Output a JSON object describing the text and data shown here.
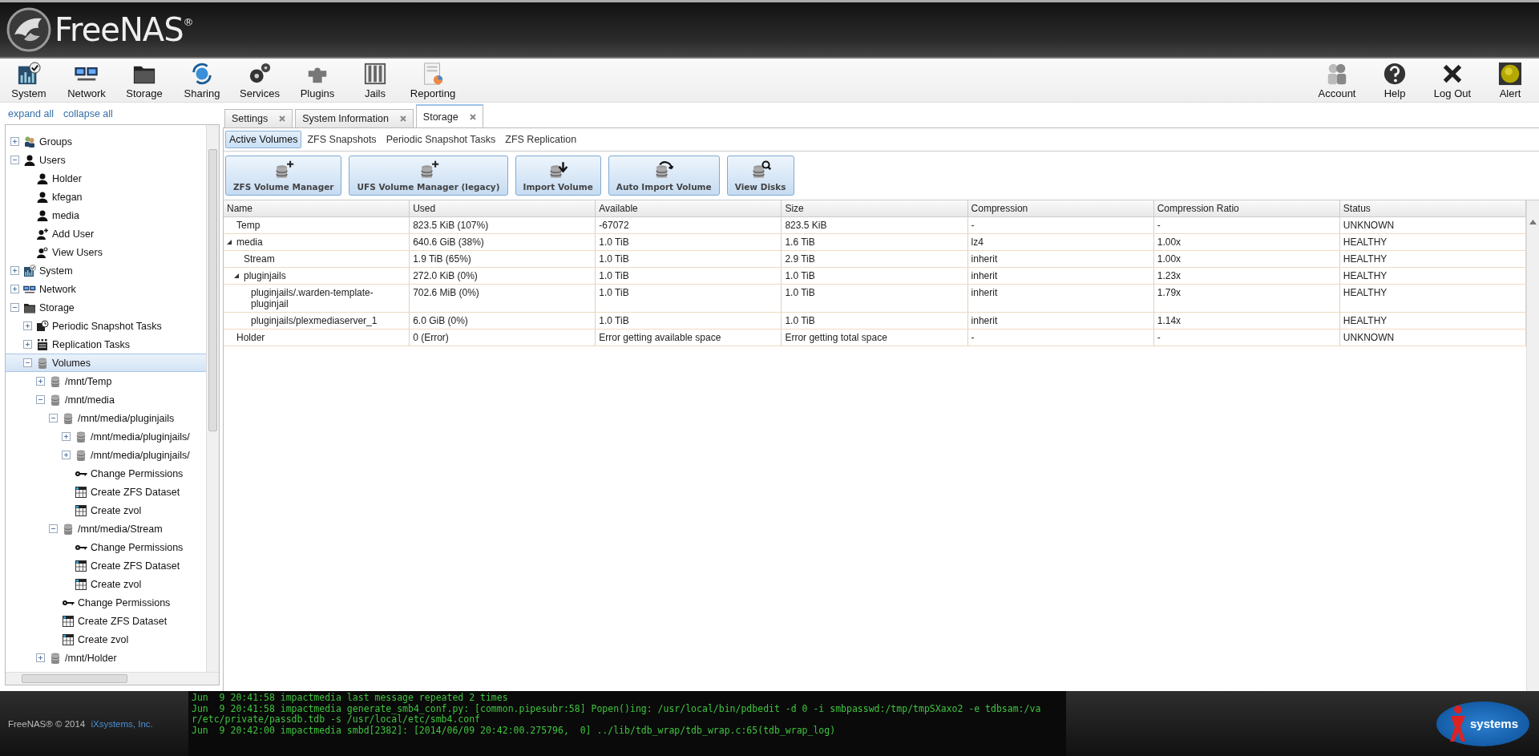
{
  "header": {
    "brand": "FreeNAS$^{®}$"
  },
  "toolbar": {
    "left": [
      {
        "label": "System",
        "kind": "system"
      },
      {
        "label": "Network",
        "kind": "network"
      },
      {
        "label": "Storage",
        "kind": "storage"
      },
      {
        "label": "Sharing",
        "kind": "sharing"
      },
      {
        "label": "Services",
        "kind": "services"
      },
      {
        "label": "Plugins",
        "kind": "plugins"
      },
      {
        "label": "Jails",
        "kind": "jails"
      },
      {
        "label": "Reporting",
        "kind": "reporting"
      }
    ],
    "right": [
      {
        "label": "Account",
        "kind": "account"
      },
      {
        "label": "Help",
        "kind": "help"
      },
      {
        "label": "Log Out",
        "kind": "logout"
      },
      {
        "label": "Alert",
        "kind": "alert"
      }
    ]
  },
  "sidebar": {
    "links": [
      "expand all",
      "collapse all"
    ],
    "tree": [
      {
        "children": [
          {
            "label": "Groups",
            "kind": "group",
            "expanded": false,
            "selected": false
          },
          {
            "label": "Users",
            "kind": "user",
            "expanded": true,
            "selected": false,
            "children": [
              {
                "label": "Holder",
                "kind": "user",
                "selected": false
              },
              {
                "label": "kfegan",
                "kind": "user",
                "selected": false
              },
              {
                "label": "media",
                "kind": "user",
                "selected": false
              },
              {
                "label": "Add User",
                "kind": "user-add",
                "selected": false
              },
              {
                "label": "View Users",
                "kind": "user-view",
                "selected": false
              }
            ]
          }
        ]
      },
      {
        "label": "System",
        "kind": "system",
        "expanded": false,
        "selected": false
      },
      {
        "label": "Network",
        "kind": "network",
        "expanded": false,
        "selected": false
      },
      {
        "label": "Storage",
        "kind": "storage",
        "expanded": true,
        "selected": false,
        "children": [
          {
            "label": "Periodic Snapshot Tasks",
            "kind": "snapshot",
            "expanded": false,
            "selected": false
          },
          {
            "label": "Replication Tasks",
            "kind": "replication",
            "expanded": false,
            "selected": false
          },
          {
            "label": "Volumes",
            "kind": "volume",
            "expanded": true,
            "selected": true,
            "children": [
              {
                "label": "/mnt/Temp",
                "kind": "volume",
                "expanded": false,
                "selected": false
              },
              {
                "label": "/mnt/media",
                "kind": "volume",
                "expanded": true,
                "selected": false,
                "children": [
                  {
                    "label": "/mnt/media/pluginjails",
                    "kind": "volume",
                    "expanded": true,
                    "selected": false,
                    "children": [
                      {
                        "label": "/mnt/media/pluginjails/",
                        "kind": "volume",
                        "expanded": false,
                        "selected": false
                      },
                      {
                        "label": "/mnt/media/pluginjails/",
                        "kind": "volume",
                        "expanded": false,
                        "selected": false
                      },
                      {
                        "label": "Change Permissions",
                        "kind": "key",
                        "selected": false
                      },
                      {
                        "label": "Create ZFS Dataset",
                        "kind": "dataset",
                        "selected": false
                      },
                      {
                        "label": "Create zvol",
                        "kind": "zvol",
                        "selected": false
                      }
                    ]
                  },
                  {
                    "label": "/mnt/media/Stream",
                    "kind": "volume",
                    "expanded": true,
                    "selected": false,
                    "children": [
                      {
                        "label": "Change Permissions",
                        "kind": "key",
                        "selected": false
                      },
                      {
                        "label": "Create ZFS Dataset",
                        "kind": "dataset",
                        "selected": false
                      },
                      {
                        "label": "Create zvol",
                        "kind": "zvol",
                        "selected": false
                      }
                    ]
                  },
                  {
                    "label": "Change Permissions",
                    "kind": "key",
                    "selected": false
                  },
                  {
                    "label": "Create ZFS Dataset",
                    "kind": "dataset",
                    "selected": false
                  },
                  {
                    "label": "Create zvol",
                    "kind": "zvol",
                    "selected": false
                  }
                ]
              },
              {
                "label": "/mnt/Holder",
                "kind": "volume",
                "expanded": false,
                "selected": false
              }
            ]
          }
        ]
      }
    ]
  },
  "tabs": [
    {
      "label": "Settings",
      "selected": false
    },
    {
      "label": "System Information",
      "selected": false
    },
    {
      "label": "Storage",
      "selected": true
    }
  ],
  "subtabs": [
    {
      "label": "Active Volumes",
      "selected": true
    },
    {
      "label": "ZFS Snapshots",
      "selected": false
    },
    {
      "label": "Periodic Snapshot Tasks",
      "selected": false
    },
    {
      "label": "ZFS Replication",
      "selected": false
    }
  ],
  "buttons": [
    {
      "label": "ZFS Volume Manager",
      "kind": "add"
    },
    {
      "label": "UFS Volume Manager (legacy)",
      "kind": "add"
    },
    {
      "label": "Import Volume",
      "kind": "import"
    },
    {
      "label": "Auto Import Volume",
      "kind": "auto"
    },
    {
      "label": "View Disks",
      "kind": "view"
    }
  ],
  "table": {
    "columns": [
      "Name",
      "Used",
      "Available",
      "Size",
      "Compression",
      "Compression Ratio",
      "Status"
    ],
    "rows": [
      {
        "cells": [
          "Temp",
          "823.5 KiB (107%)",
          "-67072",
          "823.5 KiB",
          "-",
          "-",
          "UNKNOWN"
        ]
      },
      {
        "cells": [
          "media",
          "640.6 GiB (38%)",
          "1.0 TiB",
          "1.6 TiB",
          "lz4",
          "1.00x",
          "HEALTHY"
        ],
        "expanded": true,
        "children": [
          {
            "cells": [
              "Stream",
              "1.9 TiB (65%)",
              "1.0 TiB",
              "2.9 TiB",
              "inherit",
              "1.00x",
              "HEALTHY"
            ]
          },
          {
            "cells": [
              "pluginjails",
              "272.0 KiB (0%)",
              "1.0 TiB",
              "1.0 TiB",
              "inherit",
              "1.23x",
              "HEALTHY"
            ],
            "expanded": true,
            "children": [
              {
                "cells": [
                  "pluginjails/.warden-template-pluginjail",
                  "702.6 MiB (0%)",
                  "1.0 TiB",
                  "1.0 TiB",
                  "inherit",
                  "1.79x",
                  "HEALTHY"
                ]
              },
              {
                "cells": [
                  "pluginjails/plexmediaserver_1",
                  "6.0 GiB (0%)",
                  "1.0 TiB",
                  "1.0 TiB",
                  "inherit",
                  "1.14x",
                  "HEALTHY"
                ]
              }
            ]
          }
        ]
      },
      {
        "cells": [
          "Holder",
          "0 (Error)",
          "Error getting available space",
          "Error getting total space",
          "-",
          "-",
          "UNKNOWN"
        ]
      }
    ]
  },
  "footer": {
    "copyright": "FreeNAS® © 2014",
    "link": "iXsystems, Inc.",
    "console": [
      "Jun  9 20:41:58 impactmedia last message repeated 2 times",
      "Jun  9 20:41:58 impactmedia generate_smb4_conf.py: [common.pipesubr:58] Popen()ing: /usr/local/bin/pdbedit -d 0 -i smbpasswd:/tmp/tmpSXaxo2 -e tdbsam:/var/etc/private/passdb.tdb -s /usr/local/etc/smb4.conf",
      "Jun  9 20:42:00 impactmedia smbd[2382]: [2014/06/09 20:42:00.275796,  0] ../lib/tdb_wrap/tdb_wrap.c:65(tdb_wrap_log)"
    ],
    "logo": "systems"
  }
}
